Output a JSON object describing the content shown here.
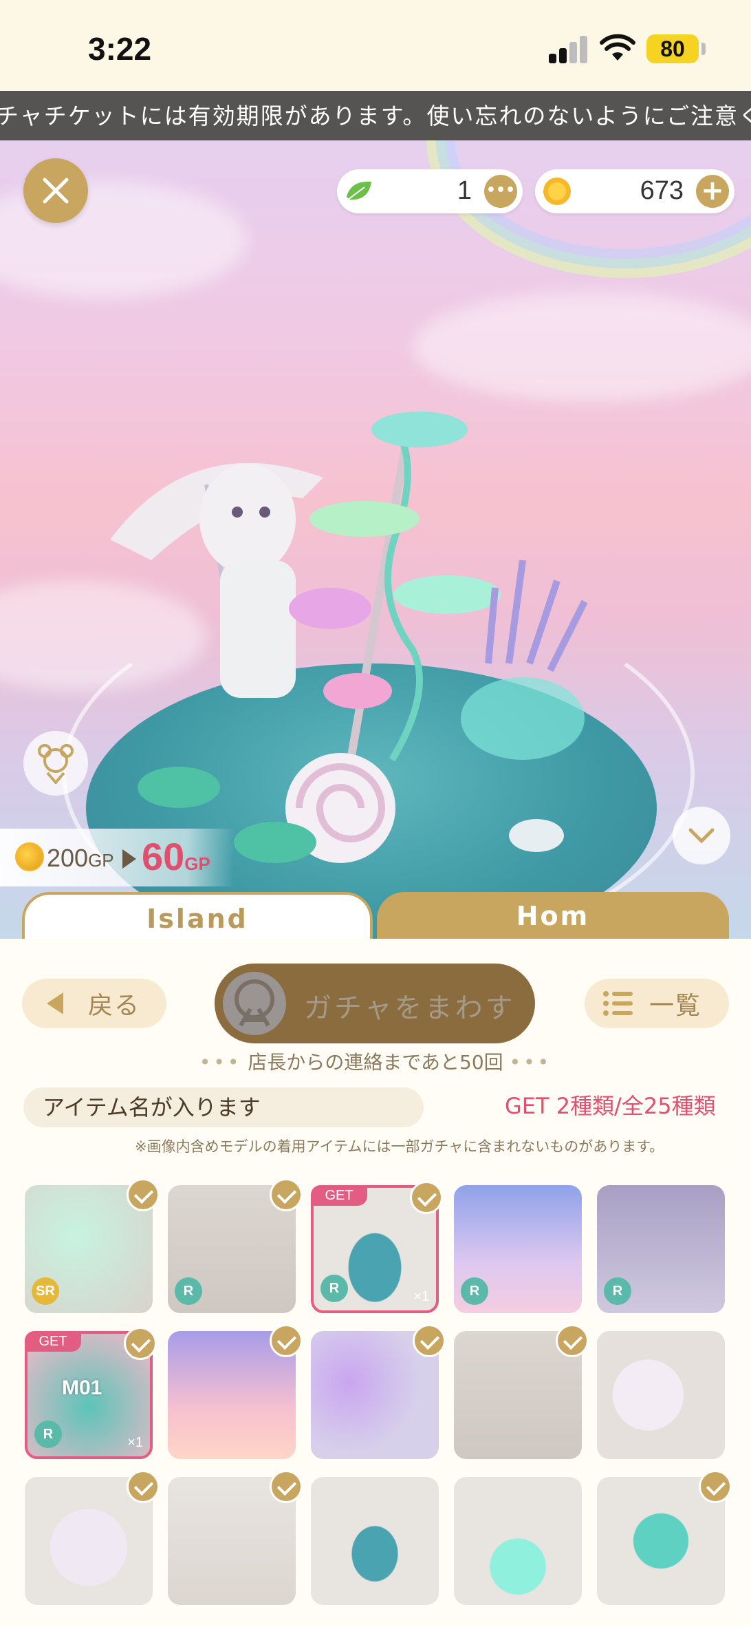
{
  "status_bar": {
    "time": "3:22",
    "battery": "80"
  },
  "ticker": {
    "text": "チャチケットには有効期限があります。使い忘れのないようにご注意く"
  },
  "currency": {
    "leaf_count": "1",
    "coin_count": "673"
  },
  "price": {
    "old_value": "200",
    "old_unit": "GP",
    "new_value": "60",
    "new_unit": "GP"
  },
  "tabs": {
    "island": "Island",
    "home": "Hom"
  },
  "actions": {
    "back": "戻る",
    "gacha": "ガチャをまわす",
    "list": "一覧"
  },
  "notice": {
    "dots_left": "•••",
    "text": "店長からの連絡まであと50回",
    "dots_right": "•••"
  },
  "item": {
    "name_placeholder": "アイテム名が入ります",
    "get_count": "GET 2種類/全25種類"
  },
  "disclaimer": "※画像内含めモデルの着用アイテムには一部ガチャに含まれないものがあります。",
  "items": [
    {
      "rarity": "SR",
      "owned": false,
      "checked": true
    },
    {
      "rarity": "R",
      "owned": false,
      "checked": true
    },
    {
      "rarity": "R",
      "owned": true,
      "checked": true,
      "badge": "GET",
      "qty": "×1"
    },
    {
      "rarity": "R",
      "owned": false,
      "checked": false
    },
    {
      "rarity": "R",
      "owned": false,
      "checked": false
    },
    {
      "rarity": "R",
      "owned": true,
      "checked": true,
      "badge": "GET",
      "qty": "×1",
      "label": "M01"
    },
    {
      "rarity": "",
      "owned": false,
      "checked": true
    },
    {
      "rarity": "",
      "owned": false,
      "checked": true
    },
    {
      "rarity": "",
      "owned": false,
      "checked": true
    },
    {
      "rarity": "",
      "owned": false,
      "checked": false
    },
    {
      "rarity": "",
      "owned": false,
      "checked": true
    },
    {
      "rarity": "",
      "owned": false,
      "checked": true
    },
    {
      "rarity": "",
      "owned": false,
      "checked": false
    },
    {
      "rarity": "",
      "owned": false,
      "checked": false
    },
    {
      "rarity": "",
      "owned": false,
      "checked": true
    }
  ]
}
